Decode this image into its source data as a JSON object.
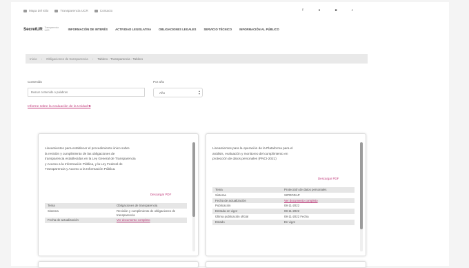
{
  "topbar": {
    "links": [
      {
        "icon": "envelope-icon",
        "label": "Mapa del sitio"
      },
      {
        "icon": "building-icon",
        "label": "Transparencia UCR"
      },
      {
        "icon": "person-icon",
        "label": "Contacto"
      }
    ],
    "social": [
      {
        "icon": "facebook-icon",
        "glyph": "f"
      },
      {
        "icon": "twitter-icon",
        "glyph": "●"
      },
      {
        "icon": "youtube-icon",
        "glyph": "■"
      },
      {
        "icon": "search-icon",
        "glyph": "⌕"
      }
    ]
  },
  "nav": {
    "logo": "SecretUR",
    "logo_sub": "Transparencia UCR",
    "items": [
      "Información de interés",
      "Actividad legislativa",
      "Obligaciones legales",
      "Servicio técnico",
      "Información al público"
    ]
  },
  "breadcrumb": [
    "Inicio",
    "Obligaciones de transparencia",
    "Tablero - Transparencia - Tablero"
  ],
  "filters": {
    "search_label": "Contenido",
    "search_placeholder": "Buscar contenido o palabras",
    "year_label": "Por año",
    "year_value": "Año",
    "report_link": "Informe sobre la evaluación de la Unidad",
    "report_icon": "external-link-icon"
  },
  "cards": [
    {
      "description": [
        "Lineamientos para establecer el procedimiento único sobre",
        "la revisión y cumplimiento de las obligaciones de",
        "transparencia establecidas en la Ley General de Transparencia",
        "y Acceso a la Información Pública, y la Ley Federal de",
        "Transparencia y Acceso a la Información Pública."
      ],
      "link": "Descargar PDF",
      "rows": [
        {
          "label": "Tema",
          "value": "Obligaciones de transparencia",
          "shade": true
        },
        {
          "label": "Sistema",
          "value": "Revisión y cumplimiento de obligaciones de transparencia",
          "shade": false
        },
        {
          "label": "Fecha de actualización",
          "value": "Ver documento completo",
          "shade": true,
          "link": true
        }
      ]
    },
    {
      "description": [
        "Lineamientos para la operación de la Plataforma para el",
        "análisis, evaluación y monitoreo del cumplimiento en",
        "protección de datos personales (PNCI-2021)"
      ],
      "link": "Descargar PDF",
      "rows": [
        {
          "label": "Tema",
          "value": "Protección de datos personales",
          "shade": true
        },
        {
          "label": "Sistema",
          "value": "SIPRODAP",
          "shade": false
        },
        {
          "label": "Fecha de actualización",
          "value": "Ver documento completo",
          "shade": true,
          "link": true
        },
        {
          "label": "Publicación",
          "value": "08-11-2022",
          "shade": false
        },
        {
          "label": "Entrada en vigor",
          "value": "08-11-2022",
          "shade": true
        },
        {
          "label": "Última publicación oficial",
          "value": "08-11-2022 Fecha",
          "shade": false
        },
        {
          "label": "Estado",
          "value": "En vigor",
          "shade": true
        }
      ]
    }
  ]
}
